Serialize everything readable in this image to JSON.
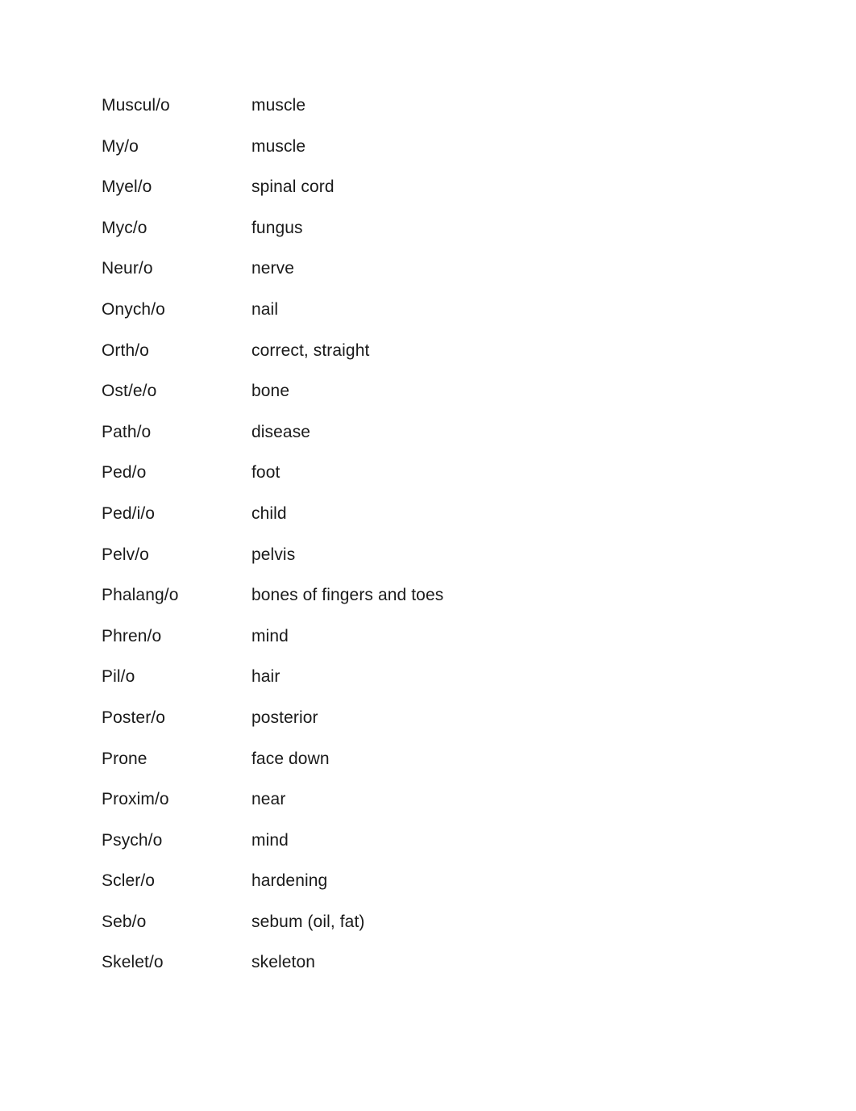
{
  "document": {
    "page_background": "#ffffff",
    "text_color": "#1a1a1a",
    "glossary": {
      "rows": [
        {
          "term": "Muscul/o",
          "meaning": "muscle"
        },
        {
          "term": "My/o",
          "meaning": "muscle"
        },
        {
          "term": "Myel/o",
          "meaning": "spinal cord"
        },
        {
          "term": "Myc/o",
          "meaning": "fungus"
        },
        {
          "term": "Neur/o",
          "meaning": "nerve"
        },
        {
          "term": "Onych/o",
          "meaning": "nail"
        },
        {
          "term": "Orth/o",
          "meaning": "correct, straight"
        },
        {
          "term": "Ost/e/o",
          "meaning": "bone"
        },
        {
          "term": "Path/o",
          "meaning": "disease"
        },
        {
          "term": "Ped/o",
          "meaning": "foot"
        },
        {
          "term": "Ped/i/o",
          "meaning": "child"
        },
        {
          "term": "Pelv/o",
          "meaning": "pelvis"
        },
        {
          "term": "Phalang/o",
          "meaning": "bones of fingers and toes"
        },
        {
          "term": "Phren/o",
          "meaning": "mind"
        },
        {
          "term": "Pil/o",
          "meaning": "hair"
        },
        {
          "term": "Poster/o",
          "meaning": "posterior"
        },
        {
          "term": "Prone",
          "meaning": "face down"
        },
        {
          "term": "Proxim/o",
          "meaning": "near"
        },
        {
          "term": "Psych/o",
          "meaning": "mind"
        },
        {
          "term": "Scler/o",
          "meaning": "hardening"
        },
        {
          "term": "Seb/o",
          "meaning": "sebum (oil, fat)"
        },
        {
          "term": "Skelet/o",
          "meaning": "skeleton"
        }
      ]
    }
  }
}
